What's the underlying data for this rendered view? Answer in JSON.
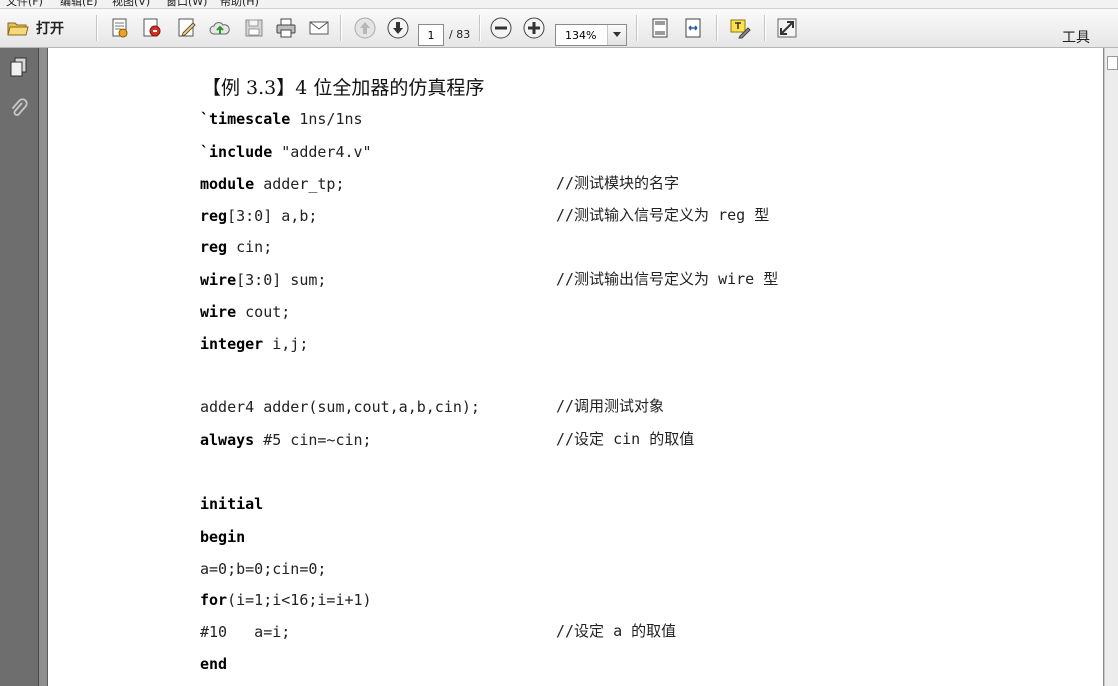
{
  "menubar": {
    "items": [
      "文件(F)",
      "编辑(E)",
      "视图(V)",
      "窗口(W)",
      "帮助(H)"
    ]
  },
  "toolbar": {
    "open_label": "打开",
    "page_current": "1",
    "page_total": "/ 83",
    "zoom": "134%",
    "tools_label": "工具"
  },
  "document": {
    "title": "【例 3.3】4 位全加器的仿真程序",
    "lines": [
      {
        "kw": "`timescale",
        "text": " 1ns/1ns",
        "comment": ""
      },
      {
        "kw": "`include",
        "text": " \"adder4.v\"",
        "comment": ""
      },
      {
        "kw": "module",
        "text": " adder_tp;",
        "comment": "//测试模块的名字"
      },
      {
        "kw": "reg",
        "text": "[3:0] a,b;",
        "comment": "//测试输入信号定义为 reg 型"
      },
      {
        "kw": "reg",
        "text": " cin;",
        "comment": ""
      },
      {
        "kw": "wire",
        "text": "[3:0] sum;",
        "comment": "//测试输出信号定义为 wire 型"
      },
      {
        "kw": "wire",
        "text": " cout;",
        "comment": ""
      },
      {
        "kw": "integer",
        "text": " i,j;",
        "comment": ""
      },
      {
        "kw": "",
        "text": "adder4 adder(sum,cout,a,b,cin);",
        "comment": "//调用测试对象"
      },
      {
        "kw": "always",
        "text": " #5 cin=~cin;",
        "comment": "//设定 cin 的取值"
      },
      {
        "kw": "initial",
        "text": "",
        "comment": ""
      },
      {
        "kw": "begin",
        "text": "",
        "comment": ""
      },
      {
        "kw": "",
        "text": "a=0;b=0;cin=0;",
        "comment": ""
      },
      {
        "kw": "for",
        "text": "(i=1;i<16;i=i+1)",
        "comment": ""
      },
      {
        "kw": "",
        "text": "#10   a=i;",
        "comment": "//设定 a 的取值"
      },
      {
        "kw": "end",
        "text": "",
        "comment": ""
      }
    ]
  },
  "colors": {
    "toolbar_bg": "#ececec",
    "sidebar_bg": "#6e6e6e",
    "page_bg": "#ffffff",
    "workspace_bg": "#8c8c8c"
  }
}
